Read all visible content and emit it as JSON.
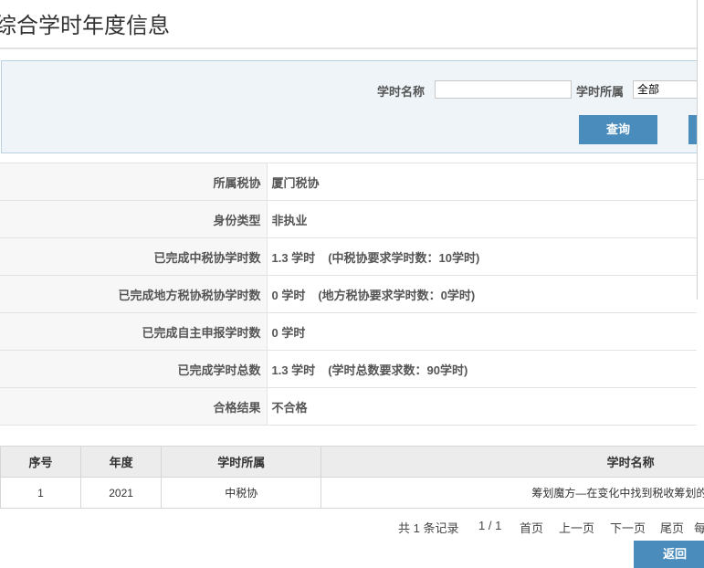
{
  "page": {
    "title": "综合学时年度信息"
  },
  "search": {
    "name_label": "学时名称",
    "name_value": "",
    "belong_label": "学时所属",
    "belong_value": "全部",
    "query_label": "查询"
  },
  "info": [
    {
      "label": "所属税协",
      "value": "厦门税协",
      "note": ""
    },
    {
      "label": "身份类型",
      "value": "非执业",
      "note": ""
    },
    {
      "label": "已完成中税协学时数",
      "value": "1.3 学时",
      "note": "(中税协要求学时数：10学时)"
    },
    {
      "label": "已完成地方税协税协学时数",
      "value": "0 学时",
      "note": "(地方税协要求学时数：0学时)"
    },
    {
      "label": "已完成自主申报学时数",
      "value": "0 学时",
      "note": ""
    },
    {
      "label": "已完成学时总数",
      "value": "1.3 学时",
      "note": "(学时总数要求数：90学时)"
    },
    {
      "label": "合格结果",
      "value": "不合格",
      "note": ""
    }
  ],
  "table": {
    "headers": [
      "序号",
      "年度",
      "学时所属",
      "学时名称"
    ],
    "rows": [
      [
        "1",
        "2021",
        "中税协",
        "筹划魔方—在变化中找到税收筹划的"
      ]
    ]
  },
  "pager": {
    "total": "共 1 条记录",
    "pages": "1 / 1",
    "first": "首页",
    "prev": "上一页",
    "next": "下一页",
    "last": "尾页",
    "per": "每"
  },
  "footer": {
    "back_label": "返回"
  },
  "colors": {
    "accent": "#4a8dbd",
    "fail": "#d30000"
  }
}
